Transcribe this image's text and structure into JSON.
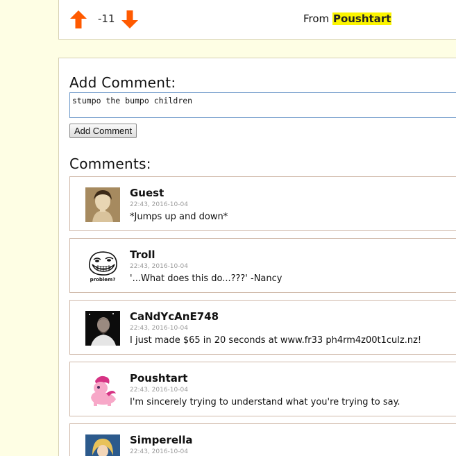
{
  "vote": {
    "score": "-11",
    "from_label": "From",
    "author": "Poushtart"
  },
  "add_comment": {
    "heading": "Add Comment:",
    "input_value": "stumpo the bumpo children",
    "button_label": "Add Comment"
  },
  "comments_heading": "Comments:",
  "comments": [
    {
      "name": "Guest",
      "time": "22:43, 2016-10-04",
      "text": "*Jumps up and down*",
      "avatar": "portrait-avatar"
    },
    {
      "name": "Troll",
      "time": "22:43, 2016-10-04",
      "text": "'...What does this do...???' -Nancy",
      "avatar": "trollface-avatar",
      "avatar_caption": "problem?"
    },
    {
      "name": "CaNdYcAnE748",
      "time": "22:43, 2016-10-04",
      "text": "I just made $65 in 20 seconds at www.fr33 ph4rm4z00t1culz.nz!",
      "avatar": "photo-avatar"
    },
    {
      "name": "Poushtart",
      "time": "22:43, 2016-10-04",
      "text": "I'm sincerely trying to understand what you're trying to say.",
      "avatar": "pony-avatar"
    },
    {
      "name": "Simperella",
      "time": "22:43, 2016-10-04",
      "text": "",
      "avatar": "princess-avatar"
    }
  ],
  "colors": {
    "background": "#fefee4",
    "arrow": "#ff5a00",
    "author_highlight": "#fbf400"
  }
}
